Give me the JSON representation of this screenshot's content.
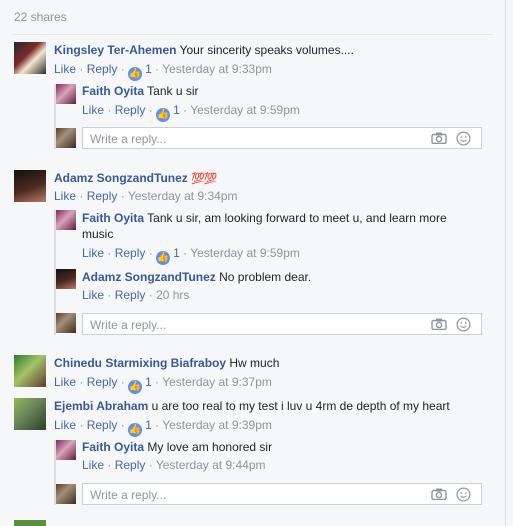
{
  "shares": "22 shares",
  "actions": {
    "like": "Like",
    "reply": "Reply",
    "dot": "·"
  },
  "reply_placeholder": "Write a reply...",
  "threads": [
    {
      "name": "Kingsley Ter-Ahemen",
      "text": "Your sincerity speaks volumes....",
      "likes": "1",
      "time": "Yesterday at 9:33pm",
      "replies": [
        {
          "name": "Faith Oyita",
          "text": "Tank u sir",
          "likes": "1",
          "time": "Yesterday at 9:59pm"
        }
      ]
    },
    {
      "name": "Adamz SongzandTunez",
      "emoji": "💯💯",
      "text": "",
      "time": "Yesterday at 9:34pm",
      "replies": [
        {
          "name": "Faith Oyita",
          "text": "Tank u sir, am looking forward to meet u, and learn more",
          "text2": "music",
          "likes": "1",
          "time": "Yesterday at 9:59pm"
        },
        {
          "name": "Adamz SongzandTunez",
          "text": "No problem dear.",
          "time": "20 hrs"
        }
      ]
    },
    {
      "name": "Chinedu Starmixing Biafraboy",
      "text": "Hw much",
      "likes": "1",
      "time": "Yesterday at 9:37pm"
    },
    {
      "name": "Ejembi Abraham",
      "text": "u are too real to my test i luv u 4rm de depth of my heart",
      "likes": "1",
      "time": "Yesterday at 9:39pm",
      "replies": [
        {
          "name": "Faith Oyita",
          "text": "My love am honored sir",
          "time": "Yesterday at 9:44pm"
        }
      ]
    }
  ]
}
